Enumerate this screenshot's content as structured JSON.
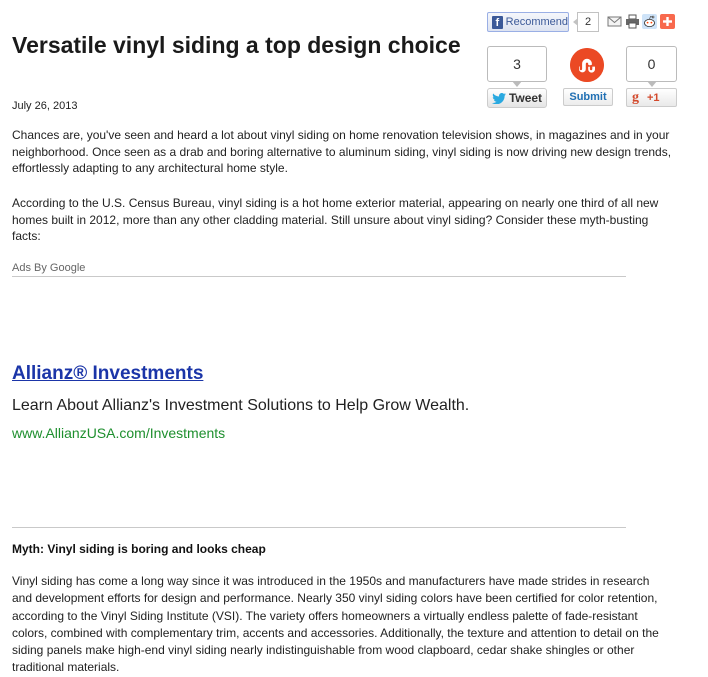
{
  "article": {
    "title": "Versatile vinyl siding a top design choice",
    "date": "July 26, 2013",
    "paragraphs": [
      "Chances are, you've seen and heard a lot about vinyl siding on home renovation television shows, in magazines and in your neighborhood. Once seen as a drab and boring alternative to aluminum siding, vinyl siding is now driving new design trends, effortlessly adapting to any architectural home style.",
      "According to the U.S. Census Bureau, vinyl siding is a hot home exterior material, appearing on nearly one third of all new homes built in 2012, more than any other cladding material. Still unsure about vinyl siding? Consider these myth-busting facts:"
    ],
    "myth_heading": "Myth: Vinyl siding is boring and looks cheap",
    "myth_paragraph": "Vinyl siding has come a long way since it was introduced in the 1950s and manufacturers have made strides in research and development efforts for design and performance. Nearly 350 vinyl siding colors have been certified for color retention, according to the Vinyl Siding Institute (VSI). The variety offers homeowners a virtually endless palette of fade-resistant colors, combined with complementary trim, accents and accessories. Additionally, the texture and attention to detail on the siding panels make high-end vinyl siding nearly indistinguishable from wood clapboard, cedar shake shingles or other traditional materials."
  },
  "ads": {
    "label": "Ads By Google",
    "title": "Allianz® Investments",
    "description": "Learn About Allianz's Investment Solutions to Help Grow Wealth.",
    "url": "www.AllianzUSA.com/Investments"
  },
  "share": {
    "facebook": {
      "label": "Recommend",
      "count": "2",
      "icon": "f"
    },
    "twitter": {
      "count": "3",
      "label": "Tweet"
    },
    "stumbleupon": {
      "label": "Submit"
    },
    "google_plus": {
      "count": "0",
      "label": "+1",
      "icon": "g"
    },
    "icons": [
      "mail-icon",
      "print-icon",
      "reddit-icon",
      "addthis-plus-icon"
    ]
  },
  "colors": {
    "link": "#1b35a8",
    "ad_url": "#1e8f2e",
    "facebook": "#3b5998",
    "stumbleupon": "#eb4924",
    "google_plus": "#d3492c",
    "twitter": "#2aa9e0"
  }
}
